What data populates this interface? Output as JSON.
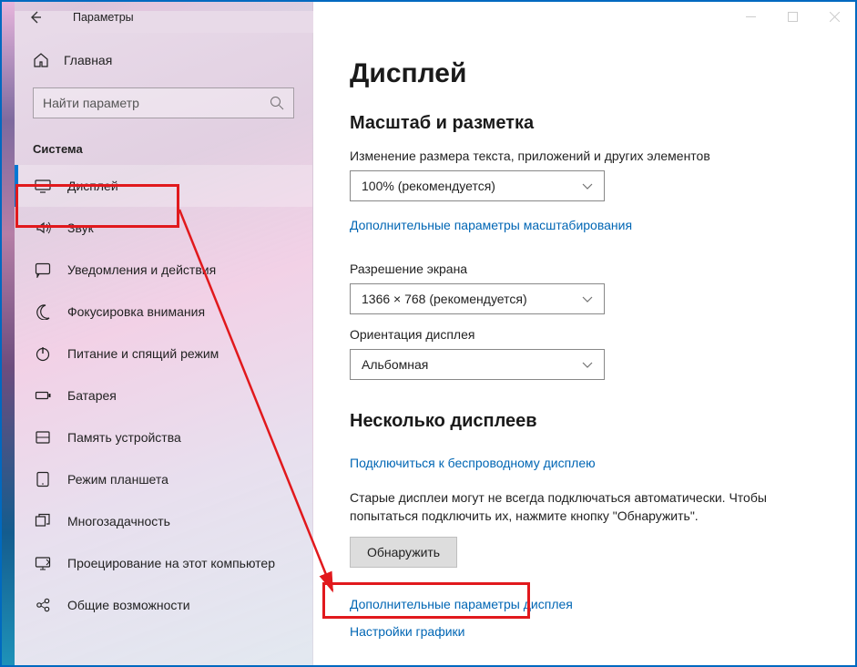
{
  "window": {
    "title": "Параметры"
  },
  "home": {
    "label": "Главная"
  },
  "search": {
    "placeholder": "Найти параметр"
  },
  "category": {
    "label": "Система"
  },
  "nav": [
    {
      "id": "display",
      "label": "Дисплей",
      "active": true,
      "icon": "monitor"
    },
    {
      "id": "sound",
      "label": "Звук",
      "active": false,
      "icon": "sound"
    },
    {
      "id": "notify",
      "label": "Уведомления и действия",
      "active": false,
      "icon": "chat"
    },
    {
      "id": "focus",
      "label": "Фокусировка внимания",
      "active": false,
      "icon": "moon"
    },
    {
      "id": "power",
      "label": "Питание и спящий режим",
      "active": false,
      "icon": "power"
    },
    {
      "id": "battery",
      "label": "Батарея",
      "active": false,
      "icon": "battery"
    },
    {
      "id": "storage",
      "label": "Память устройства",
      "active": false,
      "icon": "storage"
    },
    {
      "id": "tablet",
      "label": "Режим планшета",
      "active": false,
      "icon": "tablet"
    },
    {
      "id": "multitask",
      "label": "Многозадачность",
      "active": false,
      "icon": "multitask"
    },
    {
      "id": "project",
      "label": "Проецирование на этот компьютер",
      "active": false,
      "icon": "project"
    },
    {
      "id": "shared",
      "label": "Общие возможности",
      "active": false,
      "icon": "shared"
    }
  ],
  "main": {
    "title": "Дисплей",
    "scale_heading": "Масштаб и разметка",
    "scale_label": "Изменение размера текста, приложений и других элементов",
    "scale_value": "100% (рекомендуется)",
    "advanced_scale_link": "Дополнительные параметры масштабирования",
    "resolution_label": "Разрешение экрана",
    "resolution_value": "1366 × 768 (рекомендуется)",
    "orientation_label": "Ориентация дисплея",
    "orientation_value": "Альбомная",
    "multi_heading": "Несколько дисплеев",
    "connect_link": "Подключиться к беспроводному дисплею",
    "legacy_para": "Старые дисплеи могут не всегда подключаться автоматически. Чтобы попытаться подключить их, нажмите кнопку \"Обнаружить\".",
    "detect_btn": "Обнаружить",
    "advanced_display_link": "Дополнительные параметры дисплея",
    "graphics_link": "Настройки графики"
  }
}
